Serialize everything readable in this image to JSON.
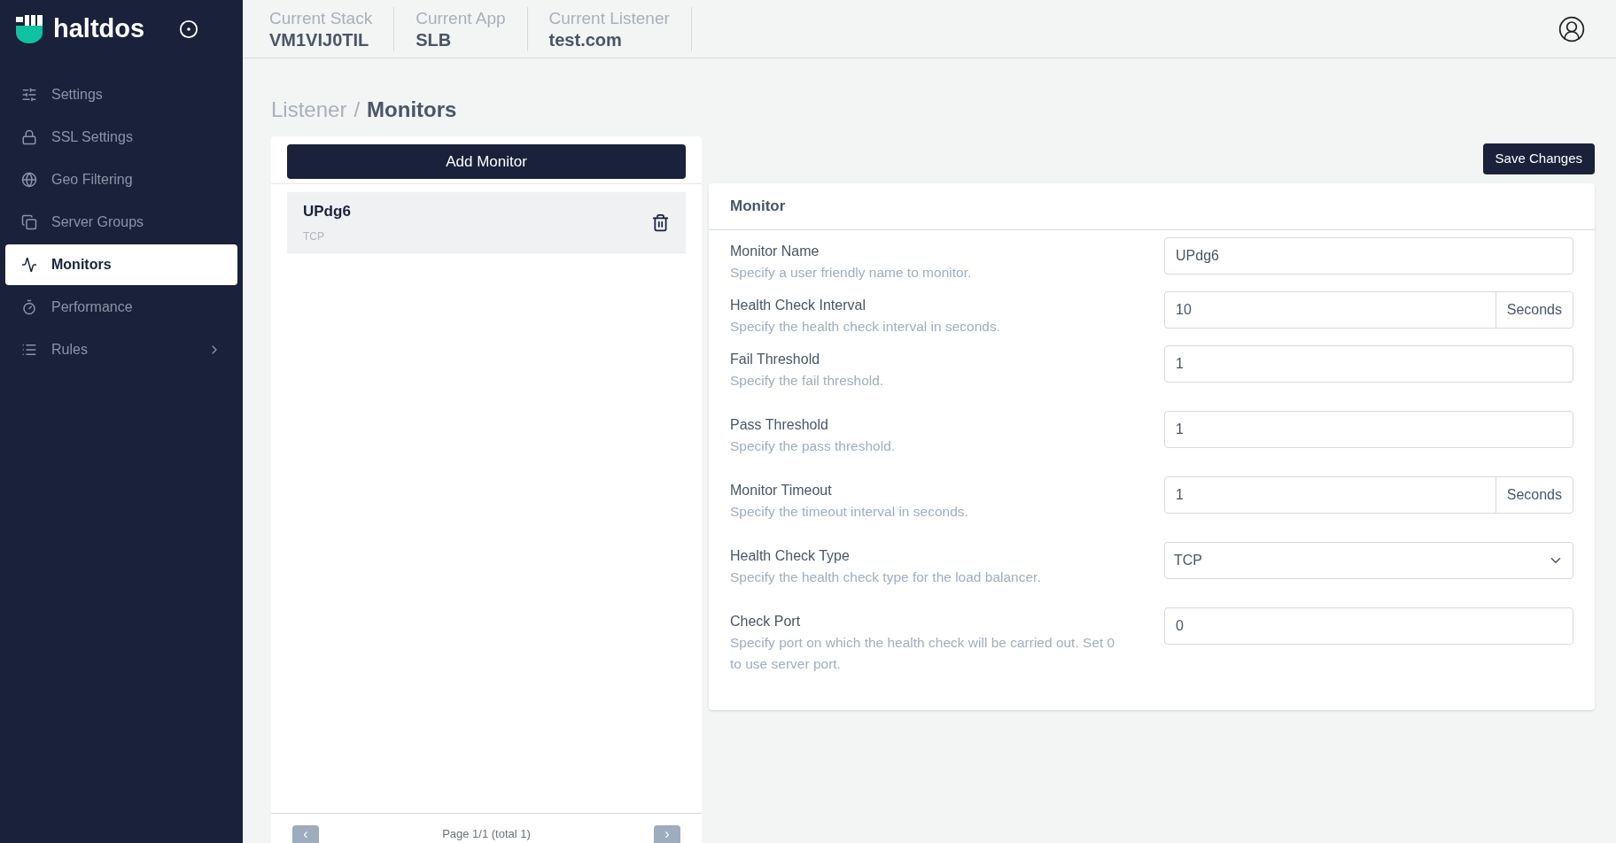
{
  "brand": {
    "name": "haltdos"
  },
  "sidebar": {
    "items": [
      {
        "label": "Settings",
        "selected": false,
        "has_submenu": false
      },
      {
        "label": "SSL Settings",
        "selected": false,
        "has_submenu": false
      },
      {
        "label": "Geo Filtering",
        "selected": false,
        "has_submenu": false
      },
      {
        "label": "Server Groups",
        "selected": false,
        "has_submenu": false
      },
      {
        "label": "Monitors",
        "selected": true,
        "has_submenu": false
      },
      {
        "label": "Performance",
        "selected": false,
        "has_submenu": false
      },
      {
        "label": "Rules",
        "selected": false,
        "has_submenu": true
      }
    ]
  },
  "header": {
    "contexts": [
      {
        "label": "Current Stack",
        "value": "VM1VIJ0TIL"
      },
      {
        "label": "Current App",
        "value": "SLB"
      },
      {
        "label": "Current Listener",
        "value": "test.com"
      }
    ]
  },
  "breadcrumb": {
    "parent": "Listener",
    "separator": "/",
    "current": "Monitors"
  },
  "monitor_list": {
    "add_button": "Add Monitor",
    "items": [
      {
        "name": "UPdg6",
        "type": "TCP",
        "selected": true
      }
    ],
    "pagination": {
      "prev": "‹",
      "text": "Page 1/1 (total 1)",
      "next": "›"
    }
  },
  "save_button": "Save Changes",
  "form": {
    "title": "Monitor",
    "fields": [
      {
        "kind": "text",
        "label": "Monitor Name",
        "help": "Specify a user friendly name to monitor.",
        "value": "UPdg6"
      },
      {
        "kind": "addon",
        "label": "Health Check Interval",
        "help": "Specify the health check interval in seconds.",
        "value": "10",
        "suffix": "Seconds"
      },
      {
        "kind": "text",
        "label": "Fail Threshold",
        "help": "Specify the fail threshold.",
        "value": "1"
      },
      {
        "kind": "text",
        "label": "Pass Threshold",
        "help": "Specify the pass threshold.",
        "value": "1"
      },
      {
        "kind": "addon",
        "label": "Monitor Timeout",
        "help": "Specify the timeout interval in seconds.",
        "value": "1",
        "suffix": "Seconds"
      },
      {
        "kind": "select",
        "label": "Health Check Type",
        "help": "Specify the health check type for the load balancer.",
        "value": "TCP"
      },
      {
        "kind": "text",
        "label": "Check Port",
        "help": "Specify port on which the health check will be carried out. Set 0 to use server port.",
        "value": "0"
      }
    ]
  }
}
